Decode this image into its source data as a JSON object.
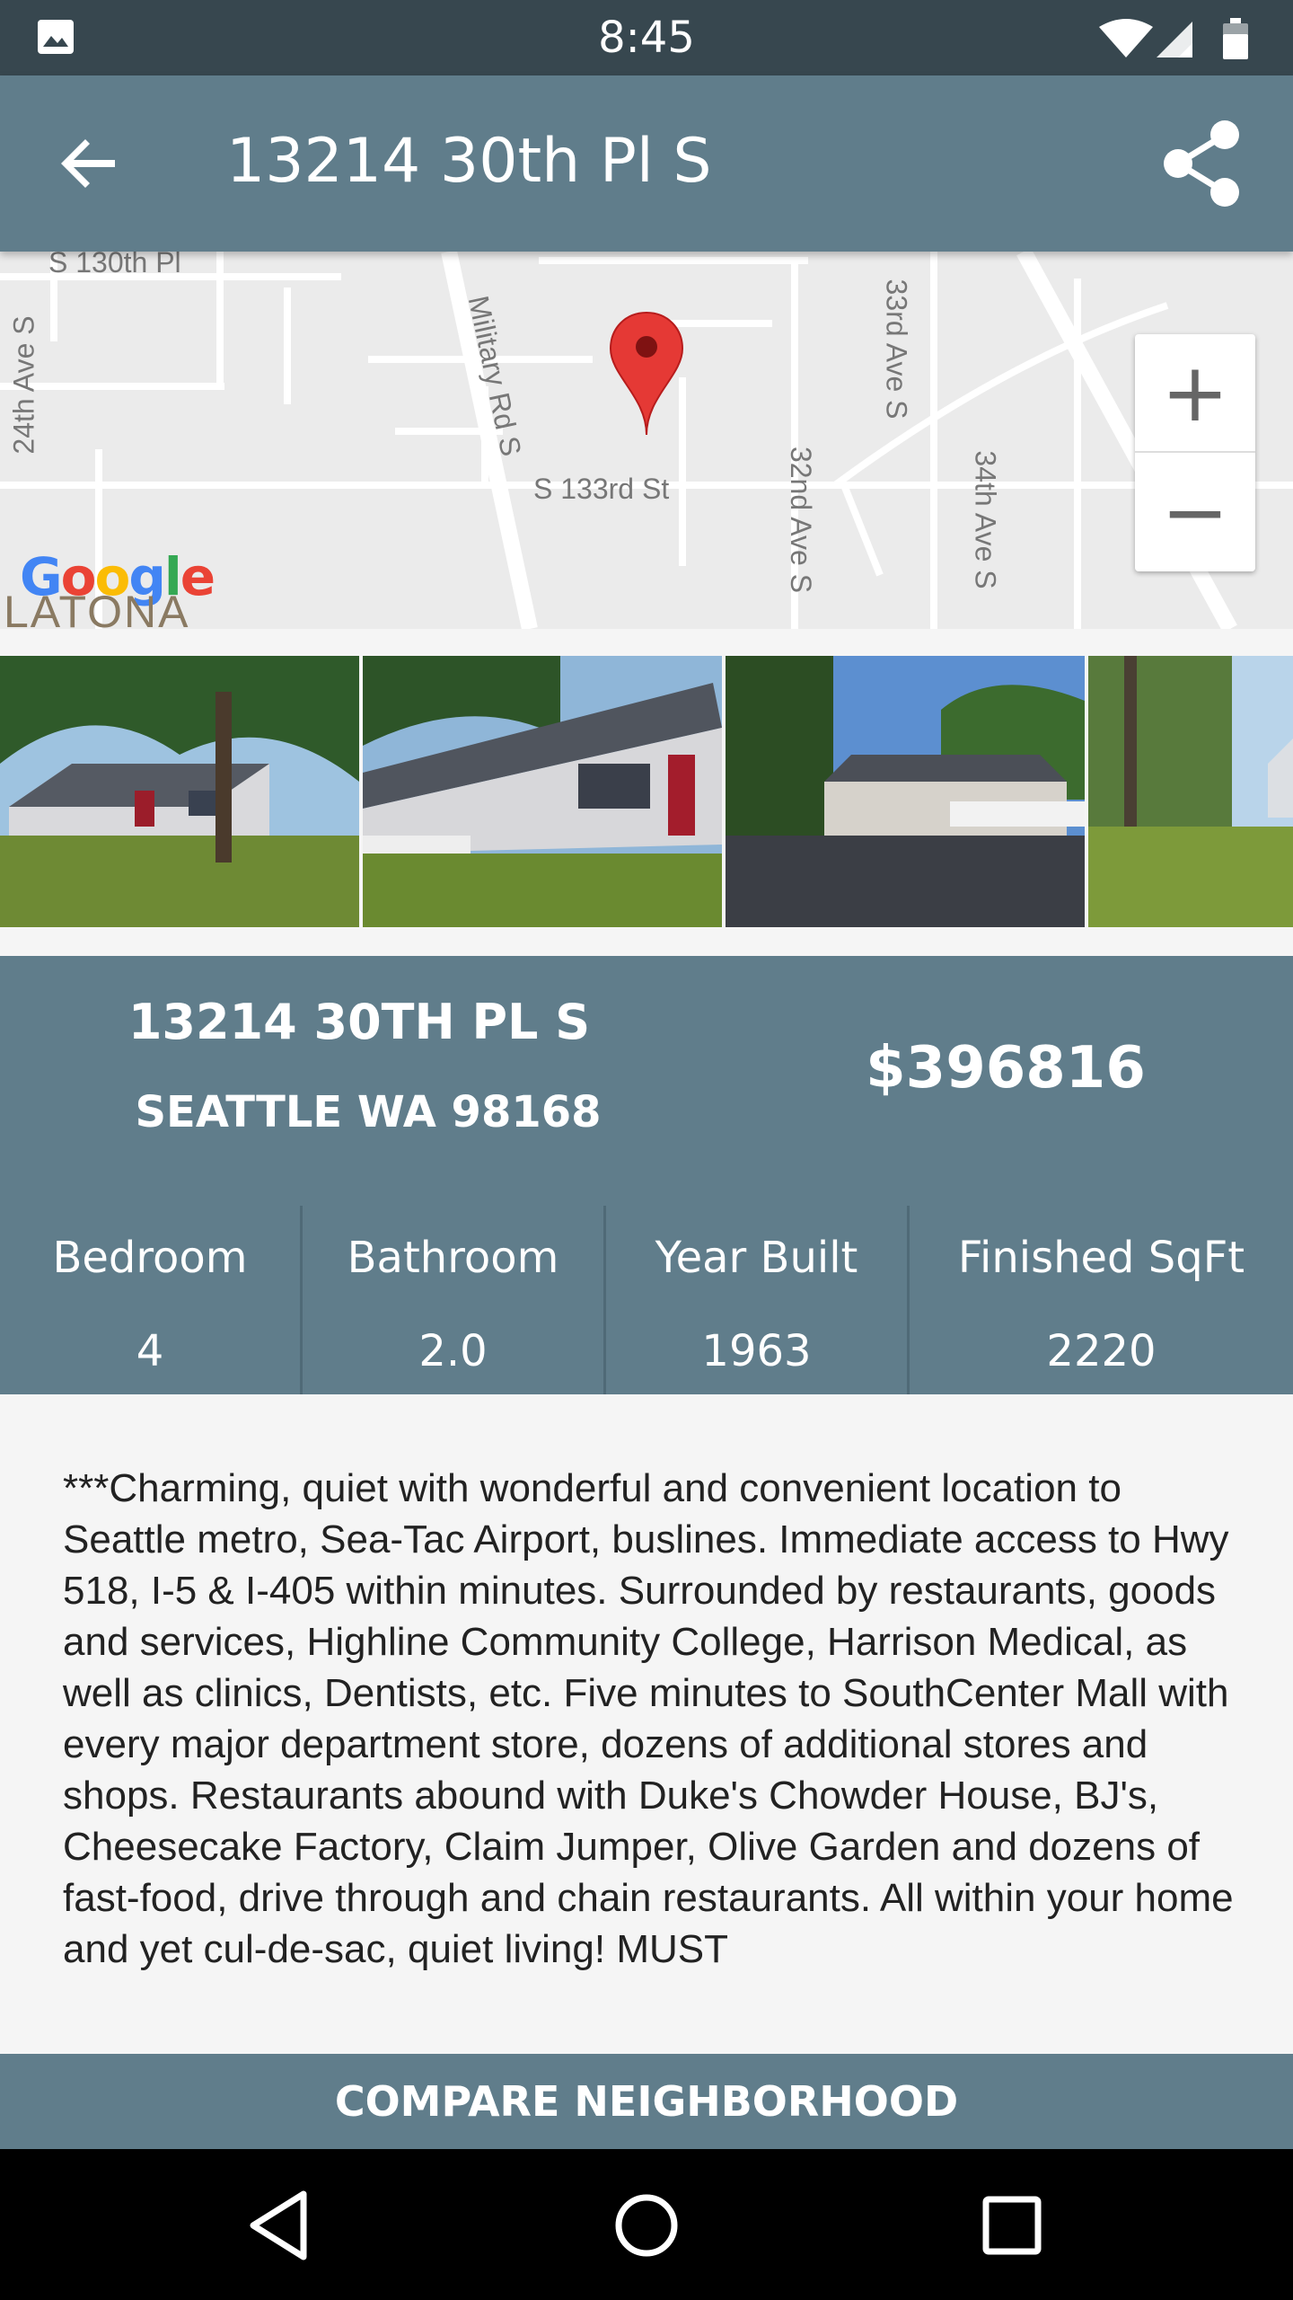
{
  "status_bar": {
    "time": "8:45",
    "icons": [
      "image-icon",
      "wifi-icon",
      "signal-icon",
      "battery-icon"
    ]
  },
  "app_bar": {
    "title": "13214 30th Pl S",
    "back_icon": "arrow-back-icon",
    "share_icon": "share-icon"
  },
  "map": {
    "streets": [
      "S 130th Pl",
      "24th Ave S",
      "Military Rd S",
      "33rd Ave S",
      "S 133rd St",
      "32nd Ave S",
      "34th Ave S"
    ],
    "attribution": "Google",
    "neighborhood_label": "LATONA",
    "zoom_in_label": "+",
    "zoom_out_label": "−",
    "pin_color": "#e53935"
  },
  "photos": [
    "house-photo-1",
    "house-photo-2",
    "house-photo-3",
    "house-photo-4"
  ],
  "listing": {
    "address_line1": "13214 30TH PL S",
    "address_line2": "SEATTLE WA 98168",
    "price": "$396816"
  },
  "stats": [
    {
      "label": "Bedroom",
      "value": "4"
    },
    {
      "label": "Bathroom",
      "value": "2.0"
    },
    {
      "label": "Year Built",
      "value": "1963"
    },
    {
      "label": "Finished SqFt",
      "value": "2220"
    }
  ],
  "description": "***Charming, quiet with wonderful and convenient  location to Seattle metro, Sea-Tac Airport, buslines.  Immediate access to Hwy 518, I-5 & I-405 within minutes. Surrounded by restaurants, goods and services, Highline Community College, Harrison Medical, as well as clinics, Dentists, etc. Five minutes to SouthCenter Mall with every major department store, dozens of additional stores and shops. Restaurants abound with Duke's Chowder House, BJ's, Cheesecake Factory, Claim Jumper, Olive Garden and dozens of fast-food, drive through and chain restaurants. All within your home and yet cul-de-sac, quiet living!  MUST",
  "compare_button": "COMPARE NEIGHBORHOOD",
  "nav_bar": [
    "nav-back-icon",
    "nav-home-icon",
    "nav-recents-icon"
  ],
  "colors": {
    "primary": "#607d8b",
    "status_bar": "#37474f",
    "background": "#f5f5f5"
  }
}
